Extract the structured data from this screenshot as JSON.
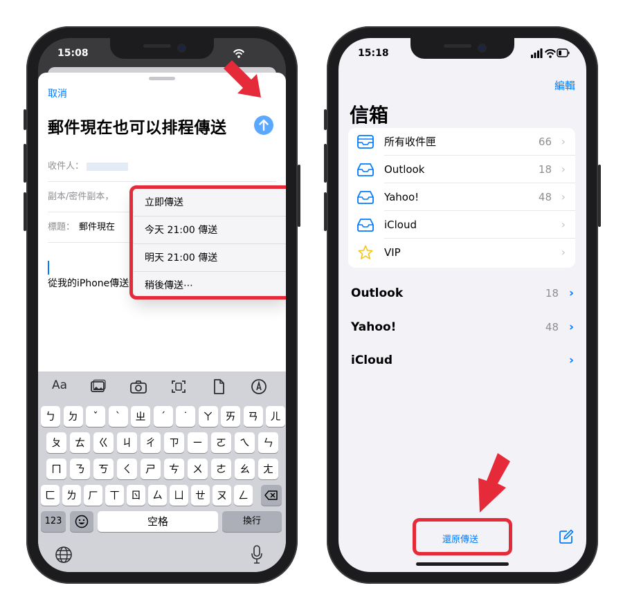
{
  "left_phone": {
    "status_time": "15:08",
    "compose": {
      "cancel_label": "取消",
      "subject_title": "郵件現在也可以排程傳送",
      "to_label": "收件人：",
      "cc_label": "副本/密件副本，",
      "subject_label": "標題：",
      "subject_value": "郵件現在",
      "signature": "從我的iPhone傳送"
    },
    "send_menu": [
      "立即傳送",
      "今天 21:00 傳送",
      "明天 21:00 傳送",
      "稍後傳送⋯"
    ],
    "keyboard": {
      "format_label": "Aa",
      "row1": [
        "ㄅ",
        "ㄉ",
        "ˇ",
        "ˋ",
        "ㄓ",
        "ˊ",
        "˙",
        "ㄚ",
        "ㄞ",
        "ㄢ",
        "ㄦ"
      ],
      "row2": [
        "ㄆ",
        "ㄊ",
        "ㄍ",
        "ㄐ",
        "ㄔ",
        "ㄗ",
        "ㄧ",
        "ㄛ",
        "ㄟ",
        "ㄣ"
      ],
      "row3": [
        "ㄇ",
        "ㄋ",
        "ㄎ",
        "ㄑ",
        "ㄕ",
        "ㄘ",
        "ㄨ",
        "ㄜ",
        "ㄠ",
        "ㄤ"
      ],
      "row4": [
        "ㄈ",
        "ㄌ",
        "ㄏ",
        "ㄒ",
        "ㄖ",
        "ㄙ",
        "ㄩ",
        "ㄝ",
        "ㄡ",
        "ㄥ"
      ],
      "numbers_label": "123",
      "space_label": "空格",
      "return_label": "換行"
    }
  },
  "right_phone": {
    "status_time": "15:18",
    "edit_label": "編輯",
    "title": "信箱",
    "mailboxes": [
      {
        "label": "所有收件匣",
        "count": "66",
        "icon": "all-inboxes-icon"
      },
      {
        "label": "Outlook",
        "count": "18",
        "icon": "inbox-icon"
      },
      {
        "label": "Yahoo!",
        "count": "48",
        "icon": "inbox-icon"
      },
      {
        "label": "iCloud",
        "count": "",
        "icon": "inbox-icon"
      },
      {
        "label": "VIP",
        "count": "",
        "icon": "star-icon"
      }
    ],
    "accounts": [
      {
        "name": "Outlook",
        "count": "18"
      },
      {
        "name": "Yahoo!",
        "count": "48"
      },
      {
        "name": "iCloud",
        "count": ""
      }
    ],
    "undo_send_label": "還原傳送"
  },
  "colors": {
    "accent": "#007aff",
    "highlight_red": "#e52a3a"
  }
}
